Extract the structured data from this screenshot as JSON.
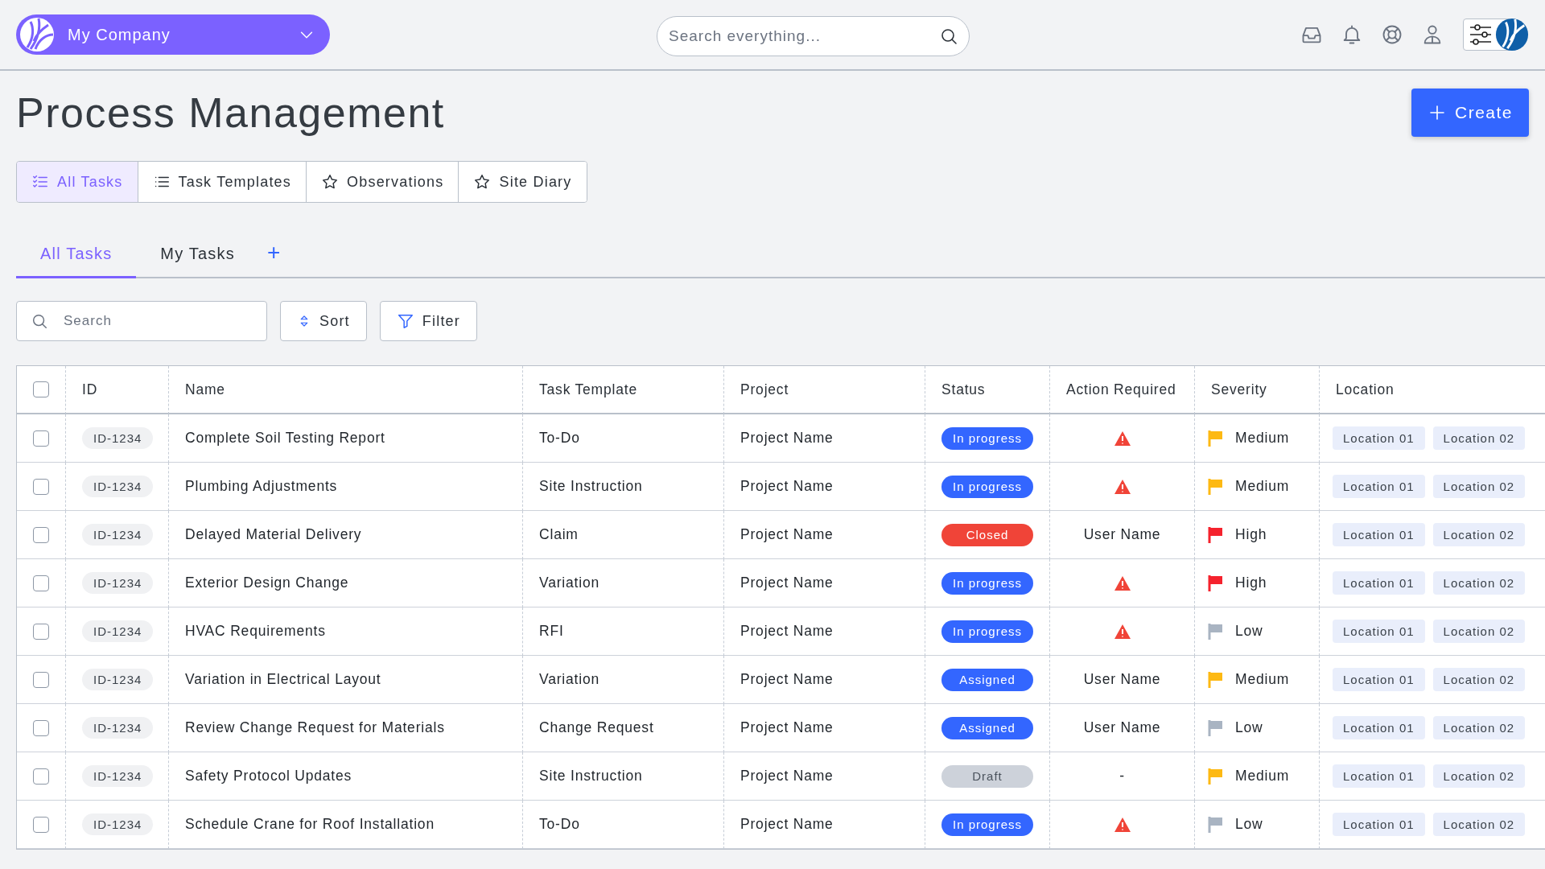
{
  "company": {
    "name": "My Company"
  },
  "global_search": {
    "placeholder": "Search everything..."
  },
  "page_title": "Process Management",
  "create_button": "Create",
  "view_tabs": [
    {
      "label": "All Tasks",
      "kind": "checklist",
      "selected": true
    },
    {
      "label": "Task Templates",
      "kind": "list",
      "selected": false
    },
    {
      "label": "Observations",
      "kind": "star",
      "selected": false
    },
    {
      "label": "Site Diary",
      "kind": "star",
      "selected": false
    }
  ],
  "filter_tabs": [
    {
      "label": "All Tasks",
      "selected": true
    },
    {
      "label": "My Tasks",
      "selected": false
    }
  ],
  "add_tab": "+",
  "search": {
    "placeholder": "Search"
  },
  "sort_button": "Sort",
  "filter_button": "Filter",
  "table": {
    "select_all": {
      "checked": false
    },
    "columns": [
      "ID",
      "Name",
      "Task Template",
      "Project",
      "Status",
      "Action Required",
      "Severity",
      "Location"
    ],
    "rows": [
      {
        "checked": false,
        "id": "ID-1234",
        "name": "Complete Soil Testing Report",
        "template": "To-Do",
        "project": "Project Name",
        "status": {
          "label": "In progress",
          "color": "#3366ff"
        },
        "action": {
          "kind": "alert"
        },
        "severity": {
          "label": "Medium",
          "color": "#fdb913"
        },
        "locations": [
          "Location 01",
          "Location 02"
        ]
      },
      {
        "checked": false,
        "id": "ID-1234",
        "name": "Plumbing Adjustments",
        "template": "Site Instruction",
        "project": "Project Name",
        "status": {
          "label": "In progress",
          "color": "#3366ff"
        },
        "action": {
          "kind": "alert"
        },
        "severity": {
          "label": "Medium",
          "color": "#fdb913"
        },
        "locations": [
          "Location 01",
          "Location 02"
        ]
      },
      {
        "checked": false,
        "id": "ID-1234",
        "name": "Delayed Material Delivery",
        "template": "Claim",
        "project": "Project Name",
        "status": {
          "label": "Closed",
          "color": "#f04438"
        },
        "action": {
          "kind": "text",
          "text": "User Name"
        },
        "severity": {
          "label": "High",
          "color": "#f5222d"
        },
        "locations": [
          "Location 01",
          "Location 02"
        ]
      },
      {
        "checked": false,
        "id": "ID-1234",
        "name": "Exterior Design Change",
        "template": "Variation",
        "project": "Project Name",
        "status": {
          "label": "In progress",
          "color": "#3366ff"
        },
        "action": {
          "kind": "alert"
        },
        "severity": {
          "label": "High",
          "color": "#f5222d"
        },
        "locations": [
          "Location 01",
          "Location 02"
        ]
      },
      {
        "checked": false,
        "id": "ID-1234",
        "name": "HVAC Requirements",
        "template": "RFI",
        "project": "Project Name",
        "status": {
          "label": "In progress",
          "color": "#3366ff"
        },
        "action": {
          "kind": "alert"
        },
        "severity": {
          "label": "Low",
          "color": "#a9b4c2"
        },
        "locations": [
          "Location 01",
          "Location 02"
        ]
      },
      {
        "checked": false,
        "id": "ID-1234",
        "name": "Variation in Electrical Layout",
        "template": "Variation",
        "project": "Project Name",
        "status": {
          "label": "Assigned",
          "color": "#3366ff"
        },
        "action": {
          "kind": "text",
          "text": "User Name"
        },
        "severity": {
          "label": "Medium",
          "color": "#fdb913"
        },
        "locations": [
          "Location 01",
          "Location 02"
        ]
      },
      {
        "checked": false,
        "id": "ID-1234",
        "name": "Review Change Request for Materials",
        "template": "Change Request",
        "project": "Project Name",
        "status": {
          "label": "Assigned",
          "color": "#3366ff"
        },
        "action": {
          "kind": "text",
          "text": "User Name"
        },
        "severity": {
          "label": "Low",
          "color": "#a9b4c2"
        },
        "locations": [
          "Location 01",
          "Location 02"
        ]
      },
      {
        "checked": false,
        "id": "ID-1234",
        "name": "Safety Protocol Updates",
        "template": "Site Instruction",
        "project": "Project Name",
        "status": {
          "label": "Draft",
          "color": "#cdd2da"
        },
        "action": {
          "kind": "text",
          "text": "-"
        },
        "severity": {
          "label": "Medium",
          "color": "#fdb913"
        },
        "locations": [
          "Location 01",
          "Location 02"
        ]
      },
      {
        "checked": false,
        "id": "ID-1234",
        "name": "Schedule Crane for Roof Installation",
        "template": "To-Do",
        "project": "Project Name",
        "status": {
          "label": "In progress",
          "color": "#3366ff"
        },
        "action": {
          "kind": "alert"
        },
        "severity": {
          "label": "Low",
          "color": "#a9b4c2"
        },
        "locations": [
          "Location 01",
          "Location 02"
        ]
      }
    ]
  }
}
